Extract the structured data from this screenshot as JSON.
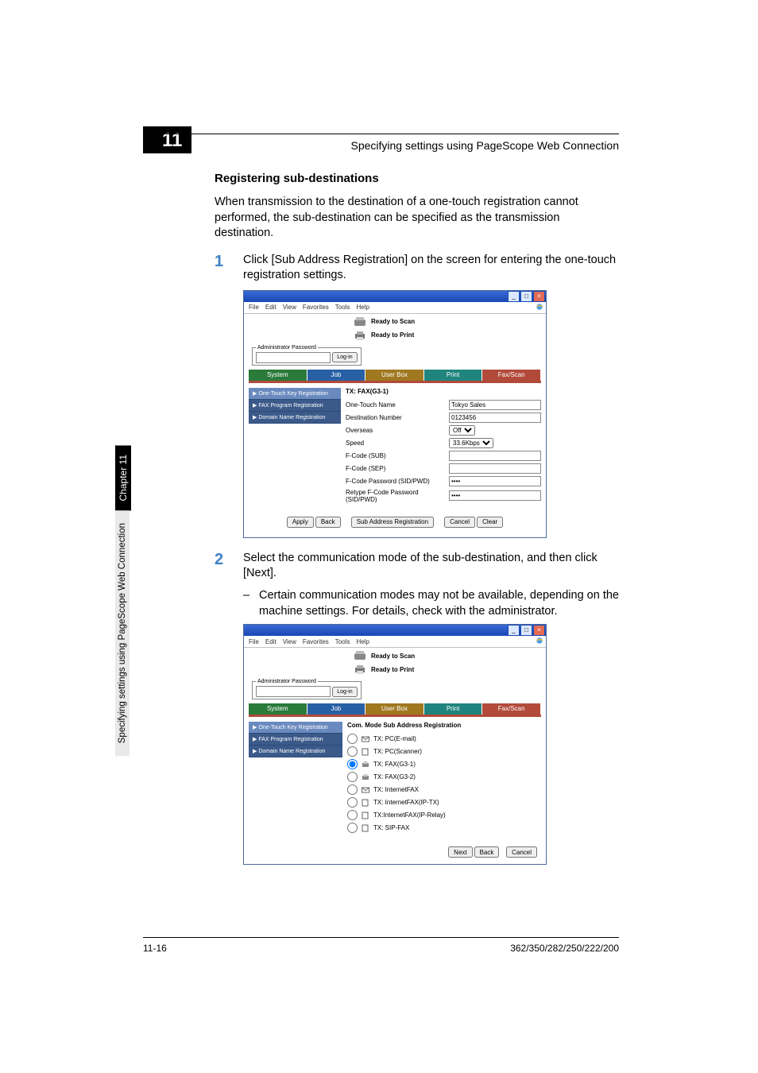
{
  "chapter_badge": "11",
  "header_title": "Specifying settings using PageScope Web Connection",
  "section_heading": "Registering sub-destinations",
  "intro_paragraph": "When transmission to the destination of a one-touch registration cannot performed, the sub-destination can be specified as the transmission destination.",
  "steps": [
    {
      "num": "1",
      "text": "Click [Sub Address Registration] on the screen for entering the one-touch registration settings."
    },
    {
      "num": "2",
      "text": "Select the communication mode of the sub-destination, and then click [Next]."
    }
  ],
  "sub_bullet": "Certain communication modes may not be available, depending on the machine settings. For details, check with the administrator.",
  "sidetab": {
    "dark": "Chapter 11",
    "light": "Specifying settings using PageScope Web Connection"
  },
  "footer": {
    "page": "11-16",
    "model": "362/350/282/250/222/200"
  },
  "browser": {
    "menus": [
      "File",
      "Edit",
      "View",
      "Favorites",
      "Tools",
      "Help"
    ],
    "status1": "Ready to Scan",
    "status2": "Ready to Print",
    "admin_legend": "Administrator Password",
    "login_btn": "Log-in",
    "tabs": [
      "System",
      "Job",
      "User Box",
      "Print",
      "Fax/Scan"
    ],
    "side_items": [
      "One-Touch Key Registration",
      "FAX Program Registration",
      "Domain Name Registration"
    ]
  },
  "shot1": {
    "heading": "TX: FAX(G3-1)",
    "fields": [
      {
        "label": "One-Touch Name",
        "value": "Tokyo Sales",
        "type": "text"
      },
      {
        "label": "Destination Number",
        "value": "0123456",
        "type": "text"
      },
      {
        "label": "Overseas",
        "type": "select",
        "value": "Off"
      },
      {
        "label": "Speed",
        "type": "select",
        "value": "33.6Kbps"
      },
      {
        "label": "F-Code (SUB)",
        "value": "",
        "type": "text"
      },
      {
        "label": "F-Code (SEP)",
        "value": "",
        "type": "text"
      },
      {
        "label": "F-Code Password (SID/PWD)",
        "value": "••••",
        "type": "password"
      },
      {
        "label": "Retype F-Code Password (SID/PWD)",
        "value": "••••",
        "type": "password"
      }
    ],
    "buttons_left": [
      "Apply",
      "Back"
    ],
    "button_mid": "Sub Address Registration",
    "buttons_right": [
      "Cancel",
      "Clear"
    ]
  },
  "shot2": {
    "heading": "Com. Mode Sub Address Registration",
    "options": [
      {
        "label": "TX: PC(E-mail)",
        "checked": false
      },
      {
        "label": "TX: PC(Scanner)",
        "checked": false
      },
      {
        "label": "TX: FAX(G3-1)",
        "checked": true
      },
      {
        "label": "TX: FAX(G3-2)",
        "checked": false
      },
      {
        "label": "TX: InternetFAX",
        "checked": false
      },
      {
        "label": "TX: InternetFAX(IP-TX)",
        "checked": false
      },
      {
        "label": "TX:InternetFAX(IP-Relay)",
        "checked": false
      },
      {
        "label": "TX: SIP-FAX",
        "checked": false
      }
    ],
    "buttons": [
      "Next",
      "Back",
      "Cancel"
    ]
  }
}
